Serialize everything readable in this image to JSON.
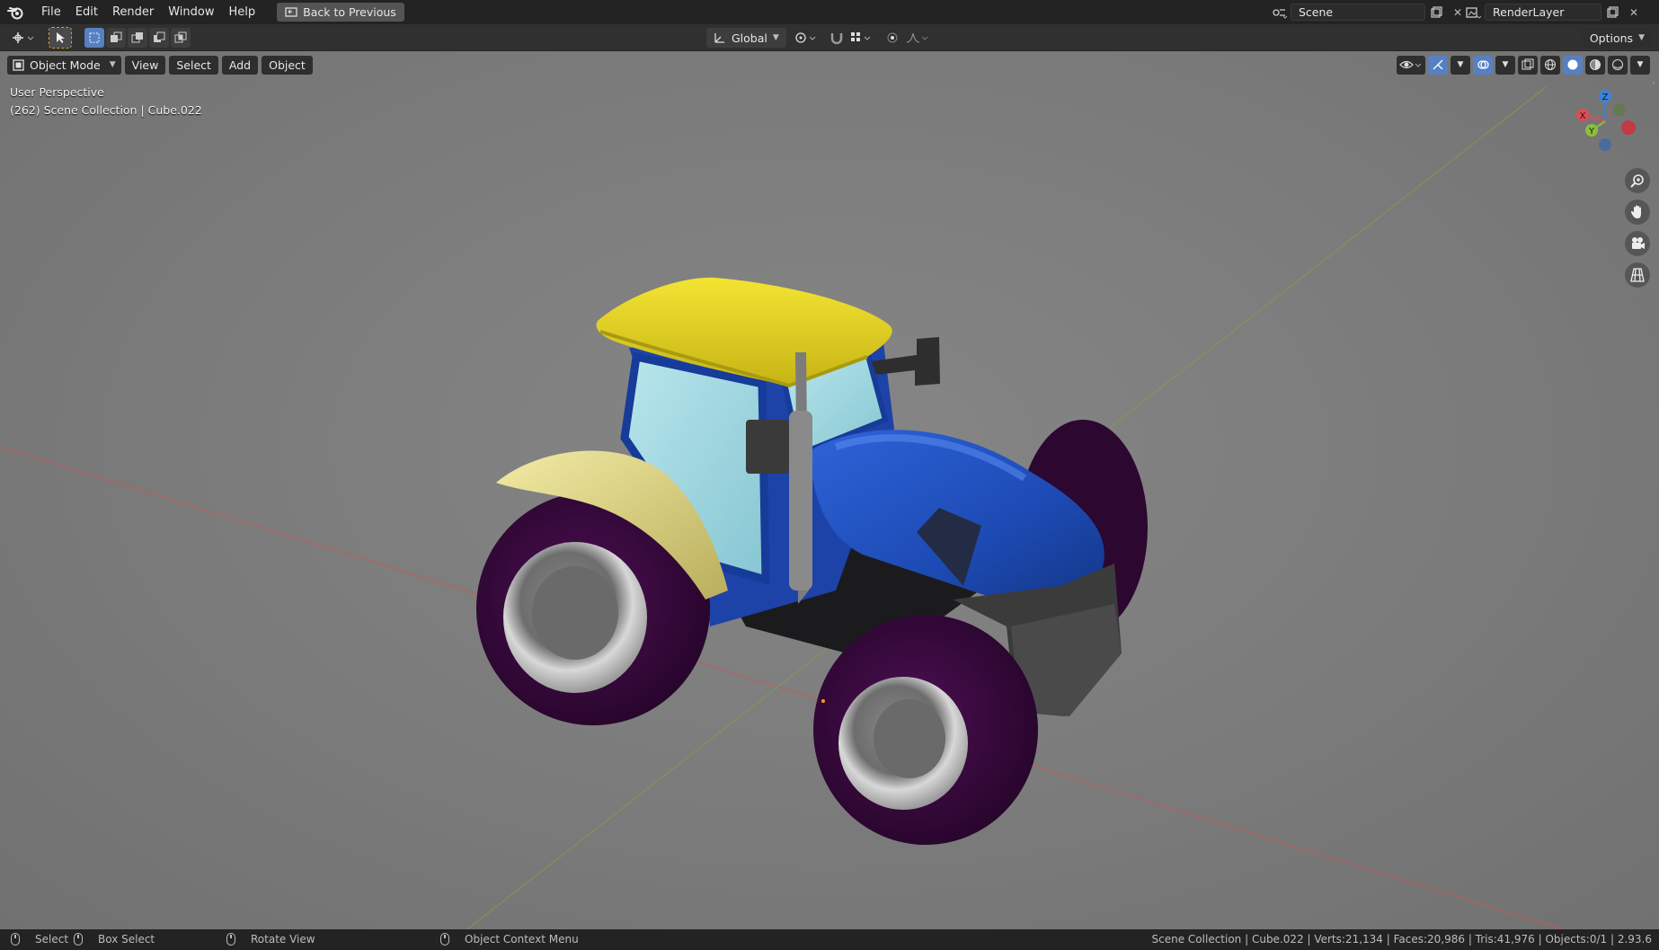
{
  "menu": {
    "items": [
      "File",
      "Edit",
      "Render",
      "Window",
      "Help"
    ],
    "back_button": "Back to Previous"
  },
  "scene": {
    "scene_name": "Scene",
    "render_layer": "RenderLayer"
  },
  "toolbar": {
    "transform_orientation": "Global",
    "options_label": "Options"
  },
  "viewport_header": {
    "mode": "Object Mode",
    "view": "View",
    "select": "Select",
    "add": "Add",
    "object": "Object"
  },
  "viewport": {
    "perspective_label": "User Perspective",
    "collection_label": "(262) Scene Collection | Cube.022"
  },
  "gizmo": {
    "x": "X",
    "y": "Y",
    "z": "Z",
    "x_color": "#e24b55",
    "y_color": "#8cbf3b",
    "z_color": "#3b82d9"
  },
  "statusbar": {
    "select": "Select",
    "box_select": "Box Select",
    "rotate_view": "Rotate View",
    "context_menu": "Object Context Menu",
    "stats": "Scene Collection | Cube.022 | Verts:21,134 | Faces:20,986 | Tris:41,976 | Objects:0/1 | 2.93.6"
  },
  "colors": {
    "accent": "#5680c2",
    "tractor_body": "#1e4fbf",
    "tractor_roof": "#e3d022",
    "tire": "#3a0a3f"
  }
}
